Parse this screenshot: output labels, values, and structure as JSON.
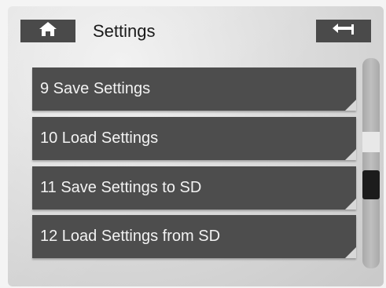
{
  "header": {
    "title": "Settings",
    "home_icon": "home-icon",
    "back_icon": "back-arrow-icon"
  },
  "menu": {
    "items": [
      {
        "label": "9 Save Settings"
      },
      {
        "label": "10 Load Settings"
      },
      {
        "label": "11 Save Settings to SD"
      },
      {
        "label": "12 Load Settings from SD"
      }
    ]
  },
  "colors": {
    "button_bg": "#4a4a4a",
    "item_bg": "#4d4d4d",
    "item_text": "#f2f2f2",
    "thumb": "#1c1c1c"
  }
}
